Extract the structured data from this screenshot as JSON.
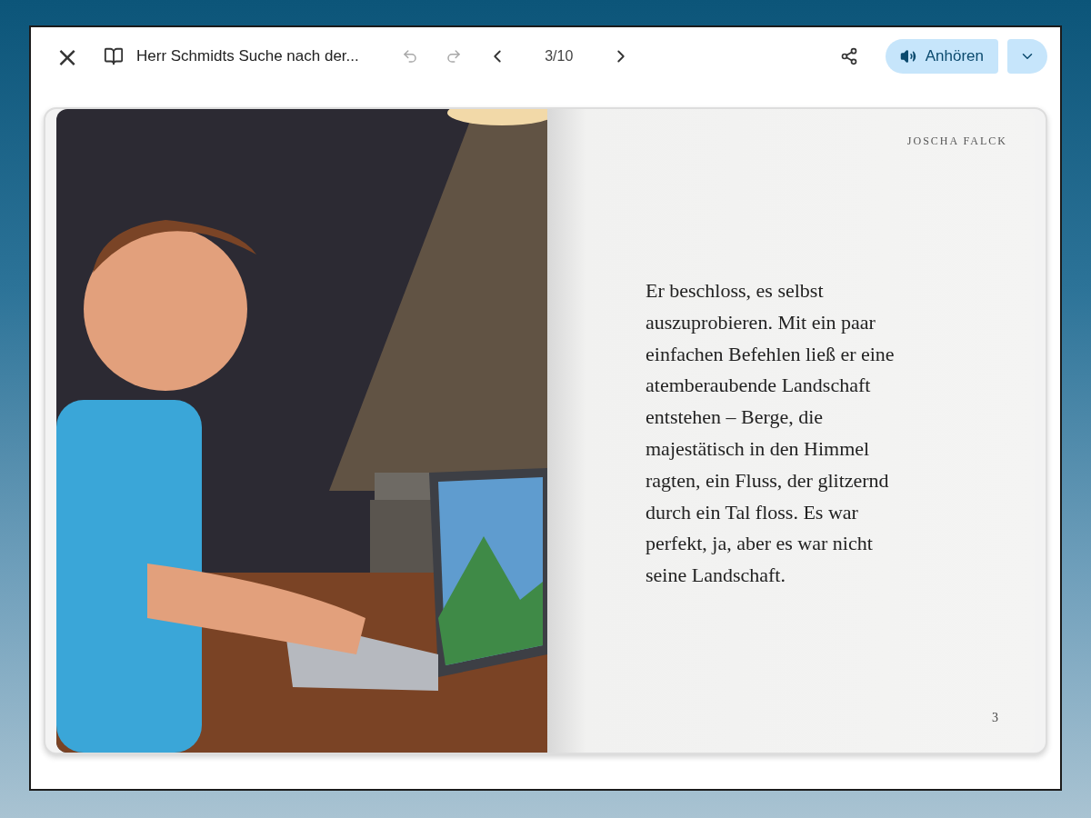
{
  "toolbar": {
    "close": "×",
    "title": "Herr Schmidts Suche nach der...",
    "undo": {
      "disabled": true
    },
    "redo": {
      "disabled": true
    },
    "page_indicator": "3/10",
    "listen_button": "Anhören"
  },
  "book": {
    "right_page": {
      "author": "JOSCHA FALCK",
      "text": "Er beschloss, es selbst auszuprobieren. Mit ein paar einfachen Befehlen ließ er eine atemberaubende Landschaft entstehen – Berge, die majestätisch in den Himmel ragten, ein Fluss, der glitzernd durch ein Tal floss. Es war perfekt, ja, aber es war nicht seine Landschaft.",
      "page_number": "3"
    }
  }
}
